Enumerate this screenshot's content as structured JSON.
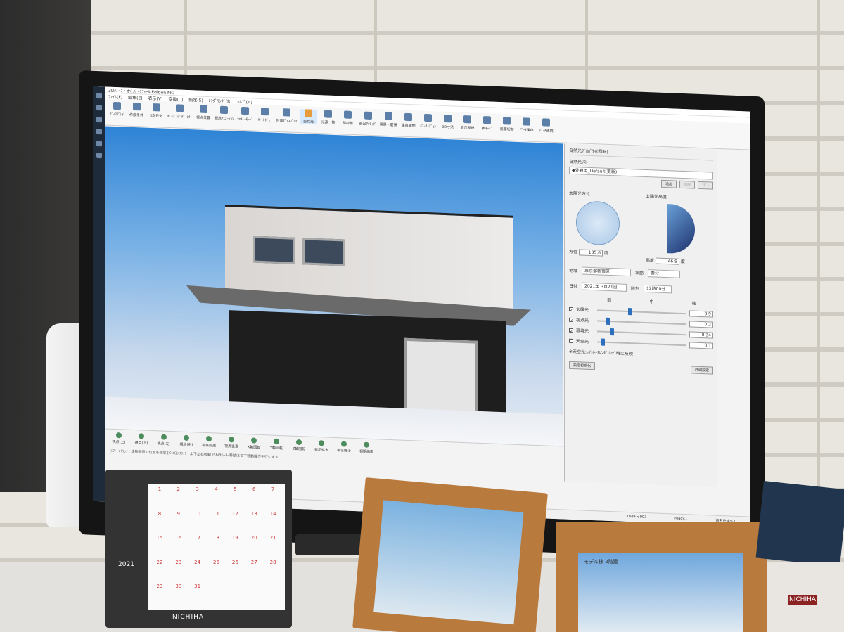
{
  "app": {
    "title": "3Dﾊﾟｰｽ・ｵﾍﾞﾊﾞｰｽﾌｨｰﾙ Edition MC",
    "menu": [
      "ﾌｧｲﾙ(F)",
      "編集(E)",
      "表示(V)",
      "変換(C)",
      "設定(S)",
      "ﾚﾝﾀﾞﾘﾝｸﾞ(R)",
      "ﾍﾙﾌﾟ(H)"
    ]
  },
  "ribbon": [
    {
      "label": "ﾃﾞｨｽﾌﾟﾚｲ"
    },
    {
      "label": "作成条件"
    },
    {
      "label": "3次元化"
    },
    {
      "label": "ﾎﾟｰｼﾞﾝｸﾞﾃﾞｨﾚｸﾄ"
    },
    {
      "label": "視点位置"
    },
    {
      "label": "視点ｱﾆﾒｰｼｮﾝ"
    },
    {
      "label": "ｼｬﾄﾞｰﾓｰﾄﾞ"
    },
    {
      "label": "ｵｰﾄﾚﾋﾞｭｰ"
    },
    {
      "label": "対面ﾃﾞｨｽﾌﾟﾚｲ"
    },
    {
      "label": "自然光"
    },
    {
      "label": "光源一覧"
    },
    {
      "label": "部材色"
    },
    {
      "label": "部品ｱｸﾃｨﾌﾞ"
    },
    {
      "label": "背景・前景"
    },
    {
      "label": "建具開閉"
    },
    {
      "label": "ﾎﾟｰﾁｭｼﾞｮﾝ"
    },
    {
      "label": "3D寸法"
    },
    {
      "label": "表示部材"
    },
    {
      "label": "表ﾓｰﾄﾞ"
    },
    {
      "label": "画面切替"
    },
    {
      "label": "ﾃﾞｰﾀ保存"
    },
    {
      "label": "ﾃﾞｰﾀ連携"
    }
  ],
  "nav": {
    "buttons": [
      "視点(上)",
      "視点(下)",
      "視点(左)",
      "視点(右)",
      "視点前進",
      "視点後退",
      "X軸回転",
      "Y軸回転",
      "Z軸回転",
      "表示拡大",
      "表示縮小",
      "初期画面"
    ],
    "hint": "[ｼﾌﾄ]+ｸﾘｯｸ : 建物配置の位置を指定     [Ctrl]+ｸﾘｯｸ : よ下左右移動     [Shift]+ｷｰ移動はで下移動操作を行います。"
  },
  "panel": {
    "title": "自然光ﾌﾟﾛﾊﾟﾃｨ(回転)",
    "list_label": "自然光ﾘｽﾄ",
    "preset": "◆外観用_Default(更新)",
    "buttons": [
      "追加",
      "削除",
      "ｺﾋﾟｰ"
    ],
    "azimuth_label": "太陽光方位",
    "altitude_label": "太陽光高度",
    "azimuth_field": "方位",
    "azimuth_value": "135.6",
    "azimuth_unit": "度",
    "altitude_field": "高度",
    "altitude_value": "46.9",
    "altitude_unit": "度",
    "region_label": "地域",
    "region_value": "東京都新宿区",
    "season_label": "季節",
    "season_value": "春分",
    "date_label": "日付",
    "date_value": "2021年 3月21日",
    "time_label": "時刻",
    "time_value": "12時00分",
    "scale": [
      "弱",
      "中",
      "強"
    ],
    "sliders": [
      {
        "label": "太陽光",
        "value": "0.9",
        "checked": true,
        "level": 0.35
      },
      {
        "label": "視点光",
        "value": "0.2",
        "checked": true,
        "level": 0.1
      },
      {
        "label": "環境光",
        "value": "0.34",
        "checked": true,
        "level": 0.15
      },
      {
        "label": "天空光",
        "value": "0.1",
        "checked": false,
        "level": 0.05
      }
    ],
    "note": "※天空光:ﾚｲﾄﾚｰｽﾚﾝﾀﾞﾘﾝｸﾞ時に反映",
    "reset_button": "設定初期化",
    "restore_button": "詳細設定"
  },
  "status": {
    "size": "1449 x 903",
    "state": "ready...",
    "mode": "両名色すべて"
  },
  "calendar": {
    "year": "2021",
    "brand": "NICHIHA",
    "days": [
      "1",
      "2",
      "3",
      "4",
      "5",
      "6",
      "7",
      "8",
      "9",
      "10",
      "11",
      "12",
      "13",
      "14",
      "15",
      "16",
      "17",
      "18",
      "19",
      "20",
      "21",
      "22",
      "23",
      "24",
      "25",
      "26",
      "27",
      "28",
      "29",
      "30",
      "31"
    ]
  },
  "photo_frame": {
    "label": "モデル棟 2階建"
  },
  "brochure": {
    "brand": "NICHIHA"
  }
}
